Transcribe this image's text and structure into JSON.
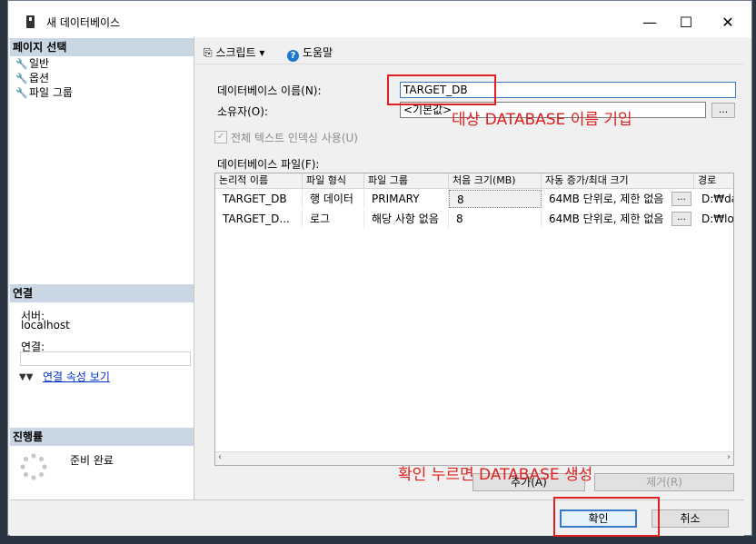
{
  "window": {
    "title": "새 데이터베이스",
    "controls": [
      "—",
      "☐",
      "✕"
    ]
  },
  "left": {
    "select_page_header": "페이지 선택",
    "pages": [
      "일반",
      "옵션",
      "파일 그룹"
    ],
    "connection_header": "연결",
    "server_label": "서버:",
    "server_value": "localhost",
    "connection_label": "연결:",
    "connection_value": "",
    "view_conn_props": "연결 속성 보기",
    "progress_header": "진행률",
    "progress_status": "준비 완료"
  },
  "toolbar": {
    "script_label": "스크립트",
    "help_label": "도움말"
  },
  "form": {
    "db_name_label": "데이터베이스 이름(N):",
    "db_name_value": "TARGET_DB",
    "owner_label": "소유자(O):",
    "owner_value": "<기본값>",
    "browse": "...",
    "fulltext_label": "전체 텍스트 인덱싱 사용(U)",
    "fulltext_checked": true,
    "files_label": "데이터베이스 파일(F):"
  },
  "grid": {
    "columns": [
      "논리적 이름",
      "파일 형식",
      "파일 그룹",
      "처음 크기(MB)",
      "자동 증가/최대 크기",
      "경로"
    ],
    "rows": [
      {
        "name": "TARGET_DB",
        "type": "행 데이터",
        "group": "PRIMARY",
        "size": "8",
        "growth": "64MB 단위로, 제한 없음",
        "path": "D:₩dat"
      },
      {
        "name": "TARGET_D...",
        "type": "로그",
        "group": "해당 사항 없음",
        "size": "8",
        "growth": "64MB 단위로, 제한 없음",
        "path": "D:₩log"
      }
    ]
  },
  "buttons": {
    "add": "추가(A)",
    "remove": "제거(R)",
    "ok": "확인",
    "cancel": "취소"
  },
  "annotations": {
    "name_hint": "대상 DATABASE 이름 기입",
    "ok_hint": "확인 누르면 DATABASE 생성",
    "color": "#e02020"
  }
}
